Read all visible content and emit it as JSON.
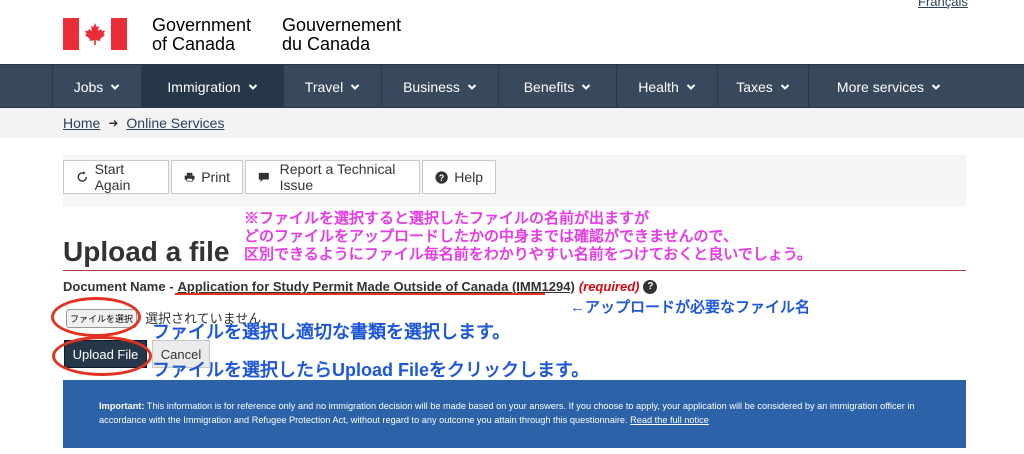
{
  "header": {
    "lang_link": "Français",
    "sig_en_line1": "Government",
    "sig_en_line2": "of Canada",
    "sig_fr_line1": "Gouvernement",
    "sig_fr_line2": "du Canada",
    "flag_colors": {
      "red": "#eb2d37",
      "white": "#ffffff"
    }
  },
  "nav": {
    "items": [
      {
        "label": "Jobs",
        "active": false
      },
      {
        "label": "Immigration",
        "active": true
      },
      {
        "label": "Travel",
        "active": false
      },
      {
        "label": "Business",
        "active": false
      },
      {
        "label": "Benefits",
        "active": false
      },
      {
        "label": "Health",
        "active": false
      },
      {
        "label": "Taxes",
        "active": false
      },
      {
        "label": "More services",
        "active": false
      }
    ]
  },
  "breadcrumb": {
    "home": "Home",
    "online_services": "Online Services"
  },
  "toolbar": {
    "start_again": "Start Again",
    "print": "Print",
    "report": "Report a Technical Issue",
    "help": "Help"
  },
  "page": {
    "title": "Upload a file",
    "doc_label": "Document Name -",
    "doc_name": "Application for Study Permit Made Outside of Canada (IMM1294)",
    "required": "(required)",
    "file_button": "ファイルを選択",
    "file_status": "選択されていません",
    "upload_button": "Upload File",
    "cancel_button": "Cancel"
  },
  "annotations": {
    "pink_line1": "※ファイルを選択すると選択したファイルの名前が出ますが",
    "pink_line2": "どのファイルをアップロードしたかの中身までは確認ができませんので、",
    "pink_line3": "区別できるようにファイル毎名前をわかりやすい名前をつけておくと良いでしょう。",
    "doc_name_note": "←アップロードが必要なファイル名",
    "select_note": "ファイルを選択し適切な書類を選択します。",
    "upload_note": "ファイルを選択したらUpload Fileをクリックします。"
  },
  "notice": {
    "important_label": "Important:",
    "text": " This information is for reference only and no immigration decision will be made based on your answers. If you choose to apply, your application will be considered by an immigration officer in accordance with the Immigration and Refugee Protection Act, without regard to any outcome you attain through this questionnaire. ",
    "link": "Read the full notice"
  },
  "colors": {
    "nav_bg": "#38495d",
    "nav_active": "#26374a",
    "accent_red": "#af3c43",
    "notice_bg": "#2b62a8",
    "annotation_pink": "#e73ce5",
    "annotation_blue": "#1e57d8",
    "annotation_circle": "#e23222"
  }
}
